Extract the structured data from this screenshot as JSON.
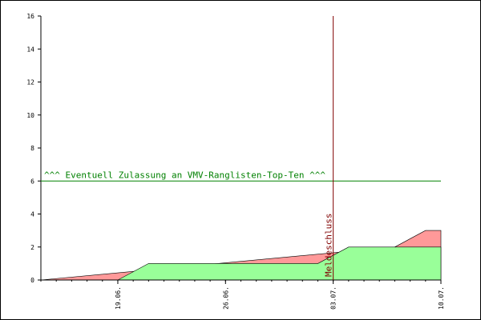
{
  "chart_data": {
    "type": "area",
    "x_axis": {
      "start": "2024-06-14",
      "end": "2024-07-10",
      "ticks": [
        {
          "date": "2024-06-19",
          "label": "19.06."
        },
        {
          "date": "2024-06-26",
          "label": "26.06."
        },
        {
          "date": "2024-07-03",
          "label": "03.07."
        },
        {
          "date": "2024-07-10",
          "label": "10.07."
        }
      ]
    },
    "ylim": [
      0,
      16
    ],
    "y_ticks": [
      0,
      2,
      4,
      6,
      8,
      10,
      12,
      14,
      16
    ],
    "grid": false,
    "series": [
      {
        "color": "#99ff99",
        "x": [
          "2024-06-14",
          "2024-06-19",
          "2024-06-21",
          "2024-07-02",
          "2024-07-04",
          "2024-07-10"
        ],
        "values": [
          0,
          0,
          1,
          1,
          2,
          2
        ]
      },
      {
        "color": "#ff9999",
        "x": [
          "2024-06-14",
          "2024-07-07",
          "2024-07-09",
          "2024-07-10"
        ],
        "values": [
          0,
          2,
          3,
          3
        ]
      }
    ],
    "threshold": {
      "value": 6,
      "label": "^^^ Eventuell Zulassung an VMV-Ranglisten-Top-Ten ^^^",
      "color": "#008000"
    },
    "deadline": {
      "date": "2024-07-03",
      "label": "Meldeschluss",
      "color": "#800000"
    }
  }
}
